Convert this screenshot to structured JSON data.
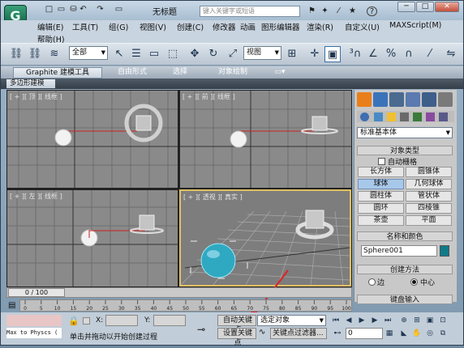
{
  "app": {
    "title": "无标题",
    "search_placeholder": "键入关键字或短语",
    "logo_glyph": "G"
  },
  "quick_access": [
    "□",
    "▭",
    "⛁",
    "↶",
    "↷",
    "▭"
  ],
  "window_buttons": [
    "─",
    "□",
    "✕"
  ],
  "title_icons": [
    "⚑",
    "✦",
    "⁄",
    "★",
    "?"
  ],
  "menu": [
    "编辑(E)",
    "工具(T)",
    "组(G)",
    "视图(V)",
    "创建(C)",
    "修改器",
    "动画",
    "图形编辑器",
    "渲染(R)",
    "自定义(U)",
    "MAXScript(M)",
    "帮助(H)"
  ],
  "toolbar": {
    "selection_filter": "全部",
    "ref_coord": "视图"
  },
  "ribbon": {
    "tabs": [
      "Graphite 建模工具",
      "自由形式",
      "选择",
      "对象绘制",
      "▭▾"
    ],
    "subtab": "多边形建模"
  },
  "viewports": [
    {
      "label": "[ + ][ 顶 ][ 线框 ]"
    },
    {
      "label": "[ + ][ 前 ][ 线框 ]"
    },
    {
      "label": "[ + ][ 左 ][ 线框 ]"
    },
    {
      "label": "[ + ][ 透视 ][ 真实 ]"
    }
  ],
  "command_panel": {
    "category": "标准基本体",
    "object_type_header": "对象类型",
    "autogrid": "自动栅格",
    "objects": [
      "长方体",
      "圆锥体",
      "球体",
      "几何球体",
      "圆柱体",
      "管状体",
      "圆环",
      "四棱锥",
      "茶壶",
      "平面"
    ],
    "selected_object": "球体",
    "name_color_header": "名称和颜色",
    "object_name": "Sphere001",
    "object_color": "#0e7a8a",
    "creation_method_header": "创建方法",
    "creation_options": [
      "边",
      "中心"
    ],
    "creation_selected": "中心",
    "keyboard_entry_header": "键盘输入"
  },
  "timeline": {
    "frame": "0 / 100",
    "ticks": [
      "0",
      "5",
      "10",
      "15",
      "20",
      "25",
      "30",
      "35",
      "40",
      "45",
      "50",
      "55",
      "60",
      "65",
      "70",
      "75",
      "80",
      "85",
      "90",
      "95",
      "100"
    ]
  },
  "status": {
    "listener": "Max to Physcs (",
    "x_label": "X:",
    "y_label": "Y:",
    "prompt": "单击并拖动以开始创建过程",
    "auto_key": "自动关键点",
    "set_key": "设置关键点",
    "key_filter_mode": "选定对象",
    "key_filters": "关键点过滤器...",
    "current_frame": "0"
  }
}
